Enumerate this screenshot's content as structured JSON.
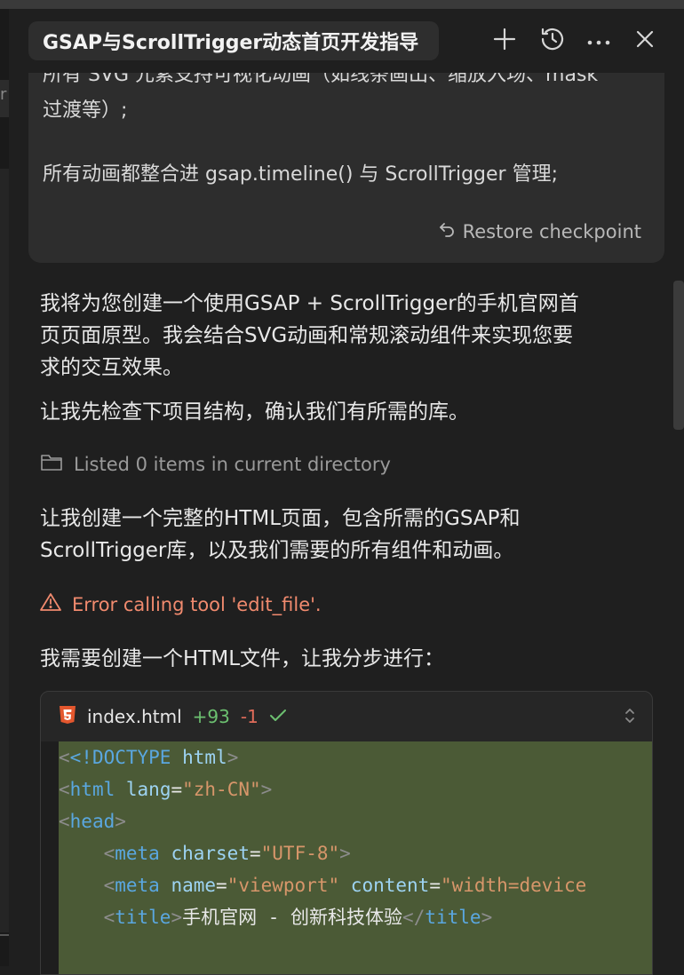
{
  "header": {
    "title": "GSAP与ScrollTrigger动态首页开发指导"
  },
  "user_message": {
    "line1": "所有 SVG 元素支持可视化动画（如线条画出、缩放入场、mask",
    "line2": "过渡等）;",
    "line3": "所有动画都整合进 gsap.timeline() 与 ScrollTrigger 管理;",
    "restore_label": "Restore checkpoint"
  },
  "assistant": {
    "p1_l1": "我将为您创建一个使用GSAP + ScrollTrigger的手机官网首",
    "p1_l2": "页页面原型。我会结合SVG动画和常规滚动组件来实现您要",
    "p1_l3": "求的交互效果。",
    "p2": "让我先检查下项目结构，确认我们有所需的库。",
    "tool_listing": "Listed 0 items in current directory",
    "p3_l1": "让我创建一个完整的HTML页面，包含所需的GSAP和",
    "p3_l2": "ScrollTrigger库，以及我们需要的所有组件和动画。",
    "error": "Error calling tool 'edit_file'.",
    "p4": "我需要创建一个HTML文件，让我分步进行："
  },
  "code_file": {
    "filename": "index.html",
    "additions": "+93",
    "deletions": "-1",
    "lines": {
      "l1_doctype": "<!DOCTYPE",
      "l1_html": "html",
      "l2_tag": "html",
      "l2_attr": "lang",
      "l2_val": "\"zh-CN\"",
      "l3_tag": "head",
      "l4_tag": "meta",
      "l4_attr": "charset",
      "l4_val": "\"UTF-8\"",
      "l5_tag": "meta",
      "l5_attr1": "name",
      "l5_val1": "\"viewport\"",
      "l5_attr2": "content",
      "l5_val2": "\"width=device",
      "l6_tag": "title",
      "l6_text": "手机官网 - 创新科技体验",
      "l6_close": "title"
    }
  },
  "colors": {
    "accent_add": "#6cc070",
    "accent_del": "#e06c5a",
    "error": "#f08a6e",
    "code_bg_added": "#4b5a36"
  }
}
